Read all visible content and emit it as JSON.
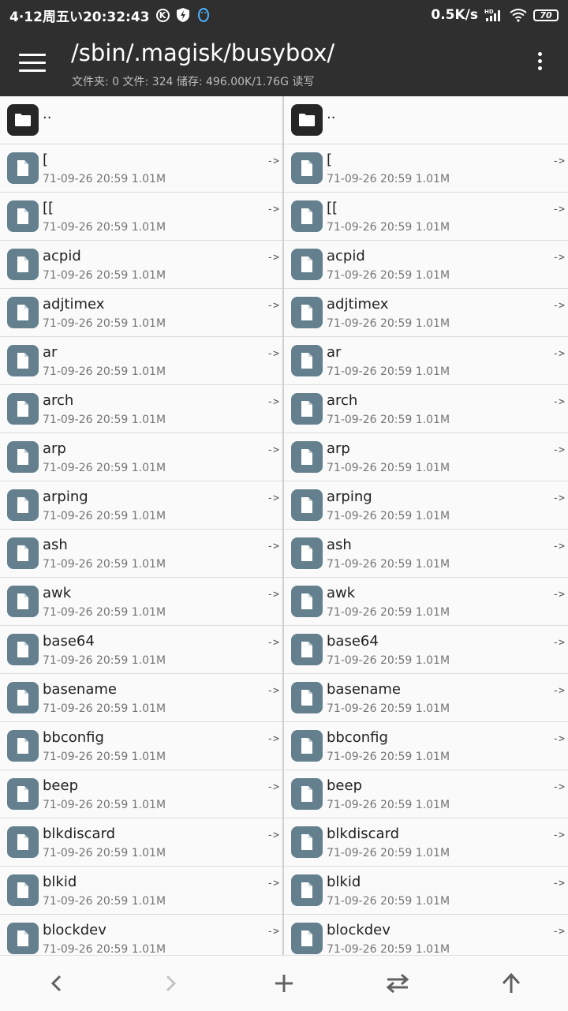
{
  "status_bar": {
    "time": "4·12周五い20:32:43",
    "k_badge": "K",
    "net_speed": "0.5K/s",
    "signal_label": "HD",
    "battery": "70",
    "icons": [
      "k-circle-icon",
      "shield-bolt-icon",
      "qq-penguin-icon",
      "hd-signal-icon",
      "wifi-icon",
      "battery-icon"
    ]
  },
  "app_bar": {
    "path": "/sbin/.magisk/busybox/",
    "info": "文件夹: 0  文件: 324  储存: 496.00K/1.76G  读写",
    "icons": [
      "menu-icon",
      "more-vert-icon"
    ]
  },
  "parent_label": "..",
  "files": [
    {
      "name": "[",
      "meta": "71-09-26 20:59  1.01M",
      "link": "->"
    },
    {
      "name": "[[",
      "meta": "71-09-26 20:59  1.01M",
      "link": "->"
    },
    {
      "name": "acpid",
      "meta": "71-09-26 20:59  1.01M",
      "link": "->"
    },
    {
      "name": "adjtimex",
      "meta": "71-09-26 20:59  1.01M",
      "link": "->"
    },
    {
      "name": "ar",
      "meta": "71-09-26 20:59  1.01M",
      "link": "->"
    },
    {
      "name": "arch",
      "meta": "71-09-26 20:59  1.01M",
      "link": "->"
    },
    {
      "name": "arp",
      "meta": "71-09-26 20:59  1.01M",
      "link": "->"
    },
    {
      "name": "arping",
      "meta": "71-09-26 20:59  1.01M",
      "link": "->"
    },
    {
      "name": "ash",
      "meta": "71-09-26 20:59  1.01M",
      "link": "->"
    },
    {
      "name": "awk",
      "meta": "71-09-26 20:59  1.01M",
      "link": "->"
    },
    {
      "name": "base64",
      "meta": "71-09-26 20:59  1.01M",
      "link": "->"
    },
    {
      "name": "basename",
      "meta": "71-09-26 20:59  1.01M",
      "link": "->"
    },
    {
      "name": "bbconfig",
      "meta": "71-09-26 20:59  1.01M",
      "link": "->"
    },
    {
      "name": "beep",
      "meta": "71-09-26 20:59  1.01M",
      "link": "->"
    },
    {
      "name": "blkdiscard",
      "meta": "71-09-26 20:59  1.01M",
      "link": "->"
    },
    {
      "name": "blkid",
      "meta": "71-09-26 20:59  1.01M",
      "link": "->"
    },
    {
      "name": "blockdev",
      "meta": "71-09-26 20:59  1.01M",
      "link": "->"
    }
  ],
  "bottom_bar": {
    "buttons": [
      {
        "name": "back-button",
        "icon": "chevron-left-icon"
      },
      {
        "name": "forward-button",
        "icon": "chevron-right-icon"
      },
      {
        "name": "add-button",
        "icon": "plus-icon"
      },
      {
        "name": "swap-panes-button",
        "icon": "swap-horizontal-icon"
      },
      {
        "name": "up-button",
        "icon": "arrow-up-icon"
      }
    ]
  },
  "colors": {
    "app_bar": "#2f2f2f",
    "file_icon": "#64808f",
    "folder_icon": "#262626",
    "background": "#fafafa"
  }
}
